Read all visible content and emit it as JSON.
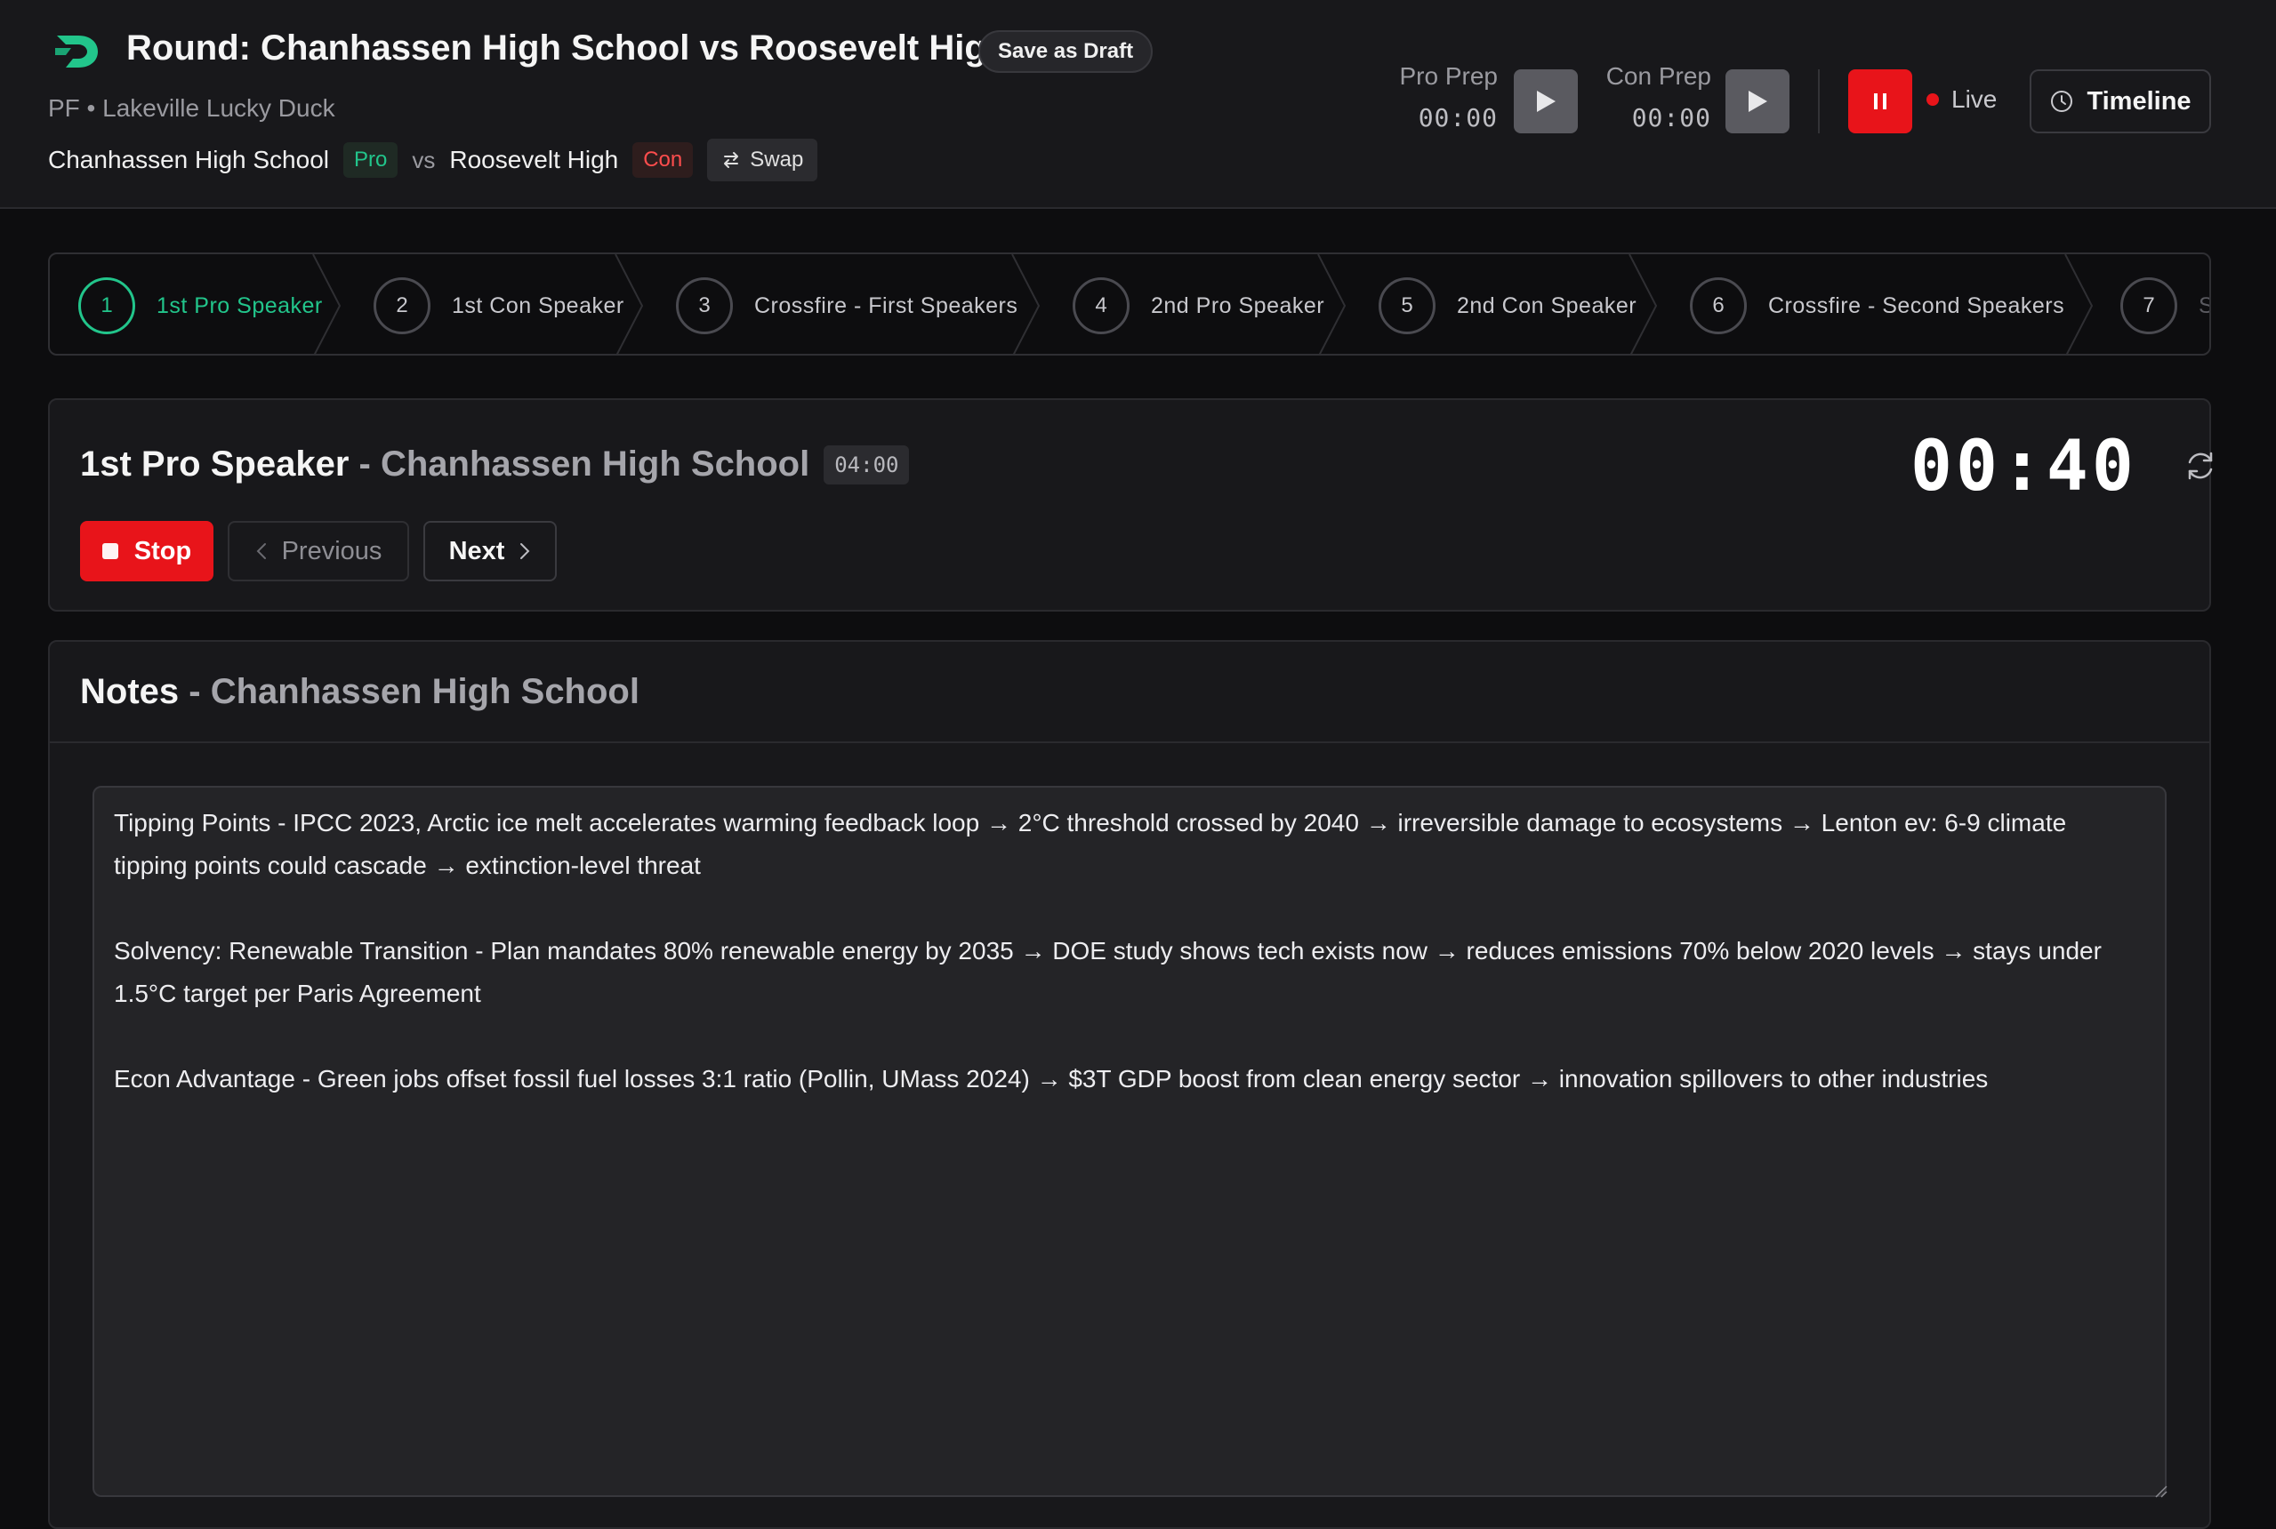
{
  "header": {
    "title": "Round: Chanhassen High School vs Roosevelt High",
    "draft_label": "Save as Draft",
    "subtitle": "PF • Lakeville Lucky Duck",
    "pro_team": "Chanhassen High School",
    "pro_side": "Pro",
    "vs": "vs",
    "con_team": "Roosevelt High",
    "con_side": "Con",
    "swap_label": "Swap",
    "pro_prep_label": "Pro Prep",
    "pro_prep_time": "00:00",
    "con_prep_label": "Con Prep",
    "con_prep_time": "00:00",
    "live_label": "Live",
    "timeline_label": "Timeline"
  },
  "steps": [
    {
      "num": "1",
      "label": "1st Pro Speaker",
      "active": true
    },
    {
      "num": "2",
      "label": "1st Con Speaker"
    },
    {
      "num": "3",
      "label": "Crossfire - First Speakers"
    },
    {
      "num": "4",
      "label": "2nd Pro Speaker"
    },
    {
      "num": "5",
      "label": "2nd Con Speaker"
    },
    {
      "num": "6",
      "label": "Crossfire - Second Speakers"
    },
    {
      "num": "7",
      "label": "S"
    }
  ],
  "speaker": {
    "role": "1st Pro Speaker",
    "separator": " - ",
    "team": "Chanhassen High School",
    "duration": "04:00",
    "timer": "00:40",
    "stop_label": "Stop",
    "prev_label": "Previous",
    "next_label": "Next"
  },
  "notes": {
    "title": "Notes",
    "separator": " - ",
    "team": "Chanhassen High School",
    "text": "Tipping Points - IPCC 2023, Arctic ice melt accelerates warming feedback loop → 2°C threshold crossed by 2040 → irreversible damage to ecosystems → Lenton ev: 6-9 climate tipping points could cascade → extinction-level threat\n\nSolvency: Renewable Transition - Plan mandates 80% renewable energy by 2035 → DOE study shows tech exists now → reduces emissions 70% below 2020 levels → stays under 1.5°C target per Paris Agreement\n\nEcon Advantage - Green jobs offset fossil fuel losses 3:1 ratio (Pollin, UMass 2024) → $3T GDP boost from clean energy sector → innovation spillovers to other industries"
  },
  "colors": {
    "accent_green": "#22c58b",
    "accent_red": "#e8141a",
    "background": "#0d0d0f",
    "panel": "#18181b"
  },
  "icons": {
    "logo": "app-logo-icon",
    "play": "play-icon",
    "pause": "pause-icon",
    "clock": "clock-icon",
    "swap": "swap-arrows-icon",
    "reset": "refresh-icon",
    "stop": "stop-icon",
    "prev": "chevron-left-icon",
    "next": "chevron-right-icon"
  }
}
